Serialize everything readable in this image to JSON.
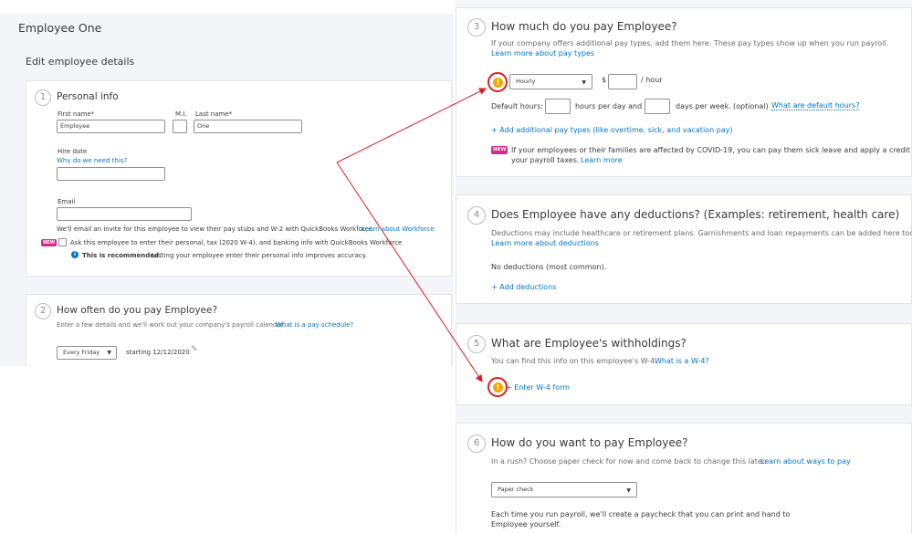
{
  "employee_name": "Employee One",
  "edit_heading": "Edit employee details",
  "personal_info": {
    "step": "1",
    "title": "Personal info",
    "first_name_label": "First name*",
    "first_name_value": "Employee",
    "mi_label": "M.I.",
    "mi_value": "",
    "last_name_label": "Last name*",
    "last_name_value": "One",
    "hire_date_label": "Hire date",
    "hire_date_link": "Why do we need this?",
    "hire_date_value": "",
    "email_label": "Email",
    "email_value": "",
    "email_note": "We'll email an invite for this employee to view their pay stubs and W-2 with QuickBooks Workforce.",
    "email_note_link": "Learn about Workforce",
    "new_badge": "NEW",
    "ask_checkbox_label": "Ask this employee to enter their personal, tax (2020 W-4), and banking info with QuickBooks Workforce",
    "recommend_bold": "This is recommended.",
    "recommend_text": "Letting your employee enter their personal info improves accuracy."
  },
  "pay_schedule": {
    "step": "2",
    "title": "How often do you pay Employee?",
    "description": "Enter a few details and we'll work out your company's payroll calendar.",
    "link": "What is a pay schedule?",
    "select_value": "Every Friday",
    "starting_text": "starting 12/12/2020"
  },
  "pay_types": {
    "step": "3",
    "title": "How much do you pay Employee?",
    "description": "If your company offers additional pay types, add them here. These pay types show up when you run payroll.",
    "link": "Learn more about pay types",
    "pay_type_value": "Hourly",
    "currency": "$",
    "rate_value": "",
    "per_hour": "/ hour",
    "default_hours_label": "Default hours:",
    "hours_per_day": "hours per day and",
    "days_per_week": "days per week.",
    "optional": "(optional)",
    "default_hours_link": "What are default hours?",
    "add_pay_types": "+ Add additional pay types (like overtime, sick, and vacation pay)",
    "new_badge": "NEW",
    "covid_text_line1": "If your employees or their families are affected by COVID-19, you can pay them sick leave and apply a credit to",
    "covid_text_line2": "your payroll taxes.",
    "covid_link": "Learn more"
  },
  "deductions": {
    "step": "4",
    "title": "Does Employee have any deductions? (Examples: retirement, health care)",
    "description": "Deductions may include healthcare or retirement plans. Garnishments and loan repayments can be added here too.",
    "link": "Learn more about deductions",
    "status": "No deductions (most common).",
    "add_link": "+ Add deductions"
  },
  "withholdings": {
    "step": "5",
    "title": "What are Employee's withholdings?",
    "description": "You can find this info on this employee's W-4.",
    "link": "What is a W-4?",
    "enter_link": "+ Enter W-4 form"
  },
  "payment": {
    "step": "6",
    "title": "How do you want to pay Employee?",
    "description": "In a rush? Choose paper check for now and come back to change this later.",
    "link": "Learn about ways to pay",
    "method_value": "Paper check",
    "note_line1": "Each time you run payroll, we'll create a paycheck that you can print and hand to",
    "note_line2": "Employee yourself."
  },
  "icons": {
    "warning": "!",
    "info": "i",
    "caret": "▼",
    "pencil": "✎"
  },
  "colors": {
    "link": "#0077c5",
    "new_badge": "#d52b8a",
    "warning": "#f0a800",
    "annotation": "#e01d1d"
  }
}
